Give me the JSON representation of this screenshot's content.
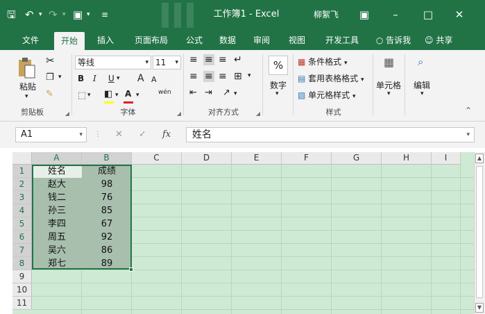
{
  "window": {
    "title": "工作簿1 - Excel",
    "user": "柳絮飞",
    "accent": "#217346"
  },
  "quick_access": {
    "save_icon": "save-icon",
    "undo_icon": "undo-icon",
    "redo_icon": "redo-icon",
    "camera_icon": "camera-icon"
  },
  "tabs": [
    "文件",
    "开始",
    "插入",
    "页面布局",
    "公式",
    "数据",
    "审阅",
    "视图",
    "开发工具"
  ],
  "active_tab": "开始",
  "tell_me": "告诉我",
  "share": "共享",
  "ribbon": {
    "clipboard": {
      "paste": "粘贴",
      "label": "剪贴板"
    },
    "font": {
      "name": "等线",
      "size": "11",
      "bold": "B",
      "italic": "I",
      "underline": "U",
      "grow": "A",
      "shrink": "A",
      "phonetic": "wén",
      "label": "字体"
    },
    "alignment": {
      "label": "对齐方式"
    },
    "number": {
      "symbol": "%",
      "label_btn": "数字"
    },
    "styles": {
      "conditional": "条件格式",
      "table": "套用表格格式",
      "cell": "单元格样式",
      "label": "样式"
    },
    "cells": {
      "label_btn": "单元格"
    },
    "editing": {
      "label_btn": "编辑"
    }
  },
  "formula_bar": {
    "name_box": "A1",
    "fx": "fx",
    "value": "姓名"
  },
  "grid": {
    "columns": [
      "A",
      "B",
      "C",
      "D",
      "E",
      "F",
      "G",
      "H",
      "I"
    ],
    "rows": [
      "1",
      "2",
      "3",
      "4",
      "5",
      "6",
      "7",
      "8",
      "9",
      "10",
      "11"
    ],
    "cells": [
      [
        "姓名",
        "成绩"
      ],
      [
        "赵大",
        "98"
      ],
      [
        "钱二",
        "76"
      ],
      [
        "孙三",
        "85"
      ],
      [
        "李四",
        "67"
      ],
      [
        "周五",
        "92"
      ],
      [
        "吴六",
        "86"
      ],
      [
        "郑七",
        "89"
      ]
    ]
  }
}
